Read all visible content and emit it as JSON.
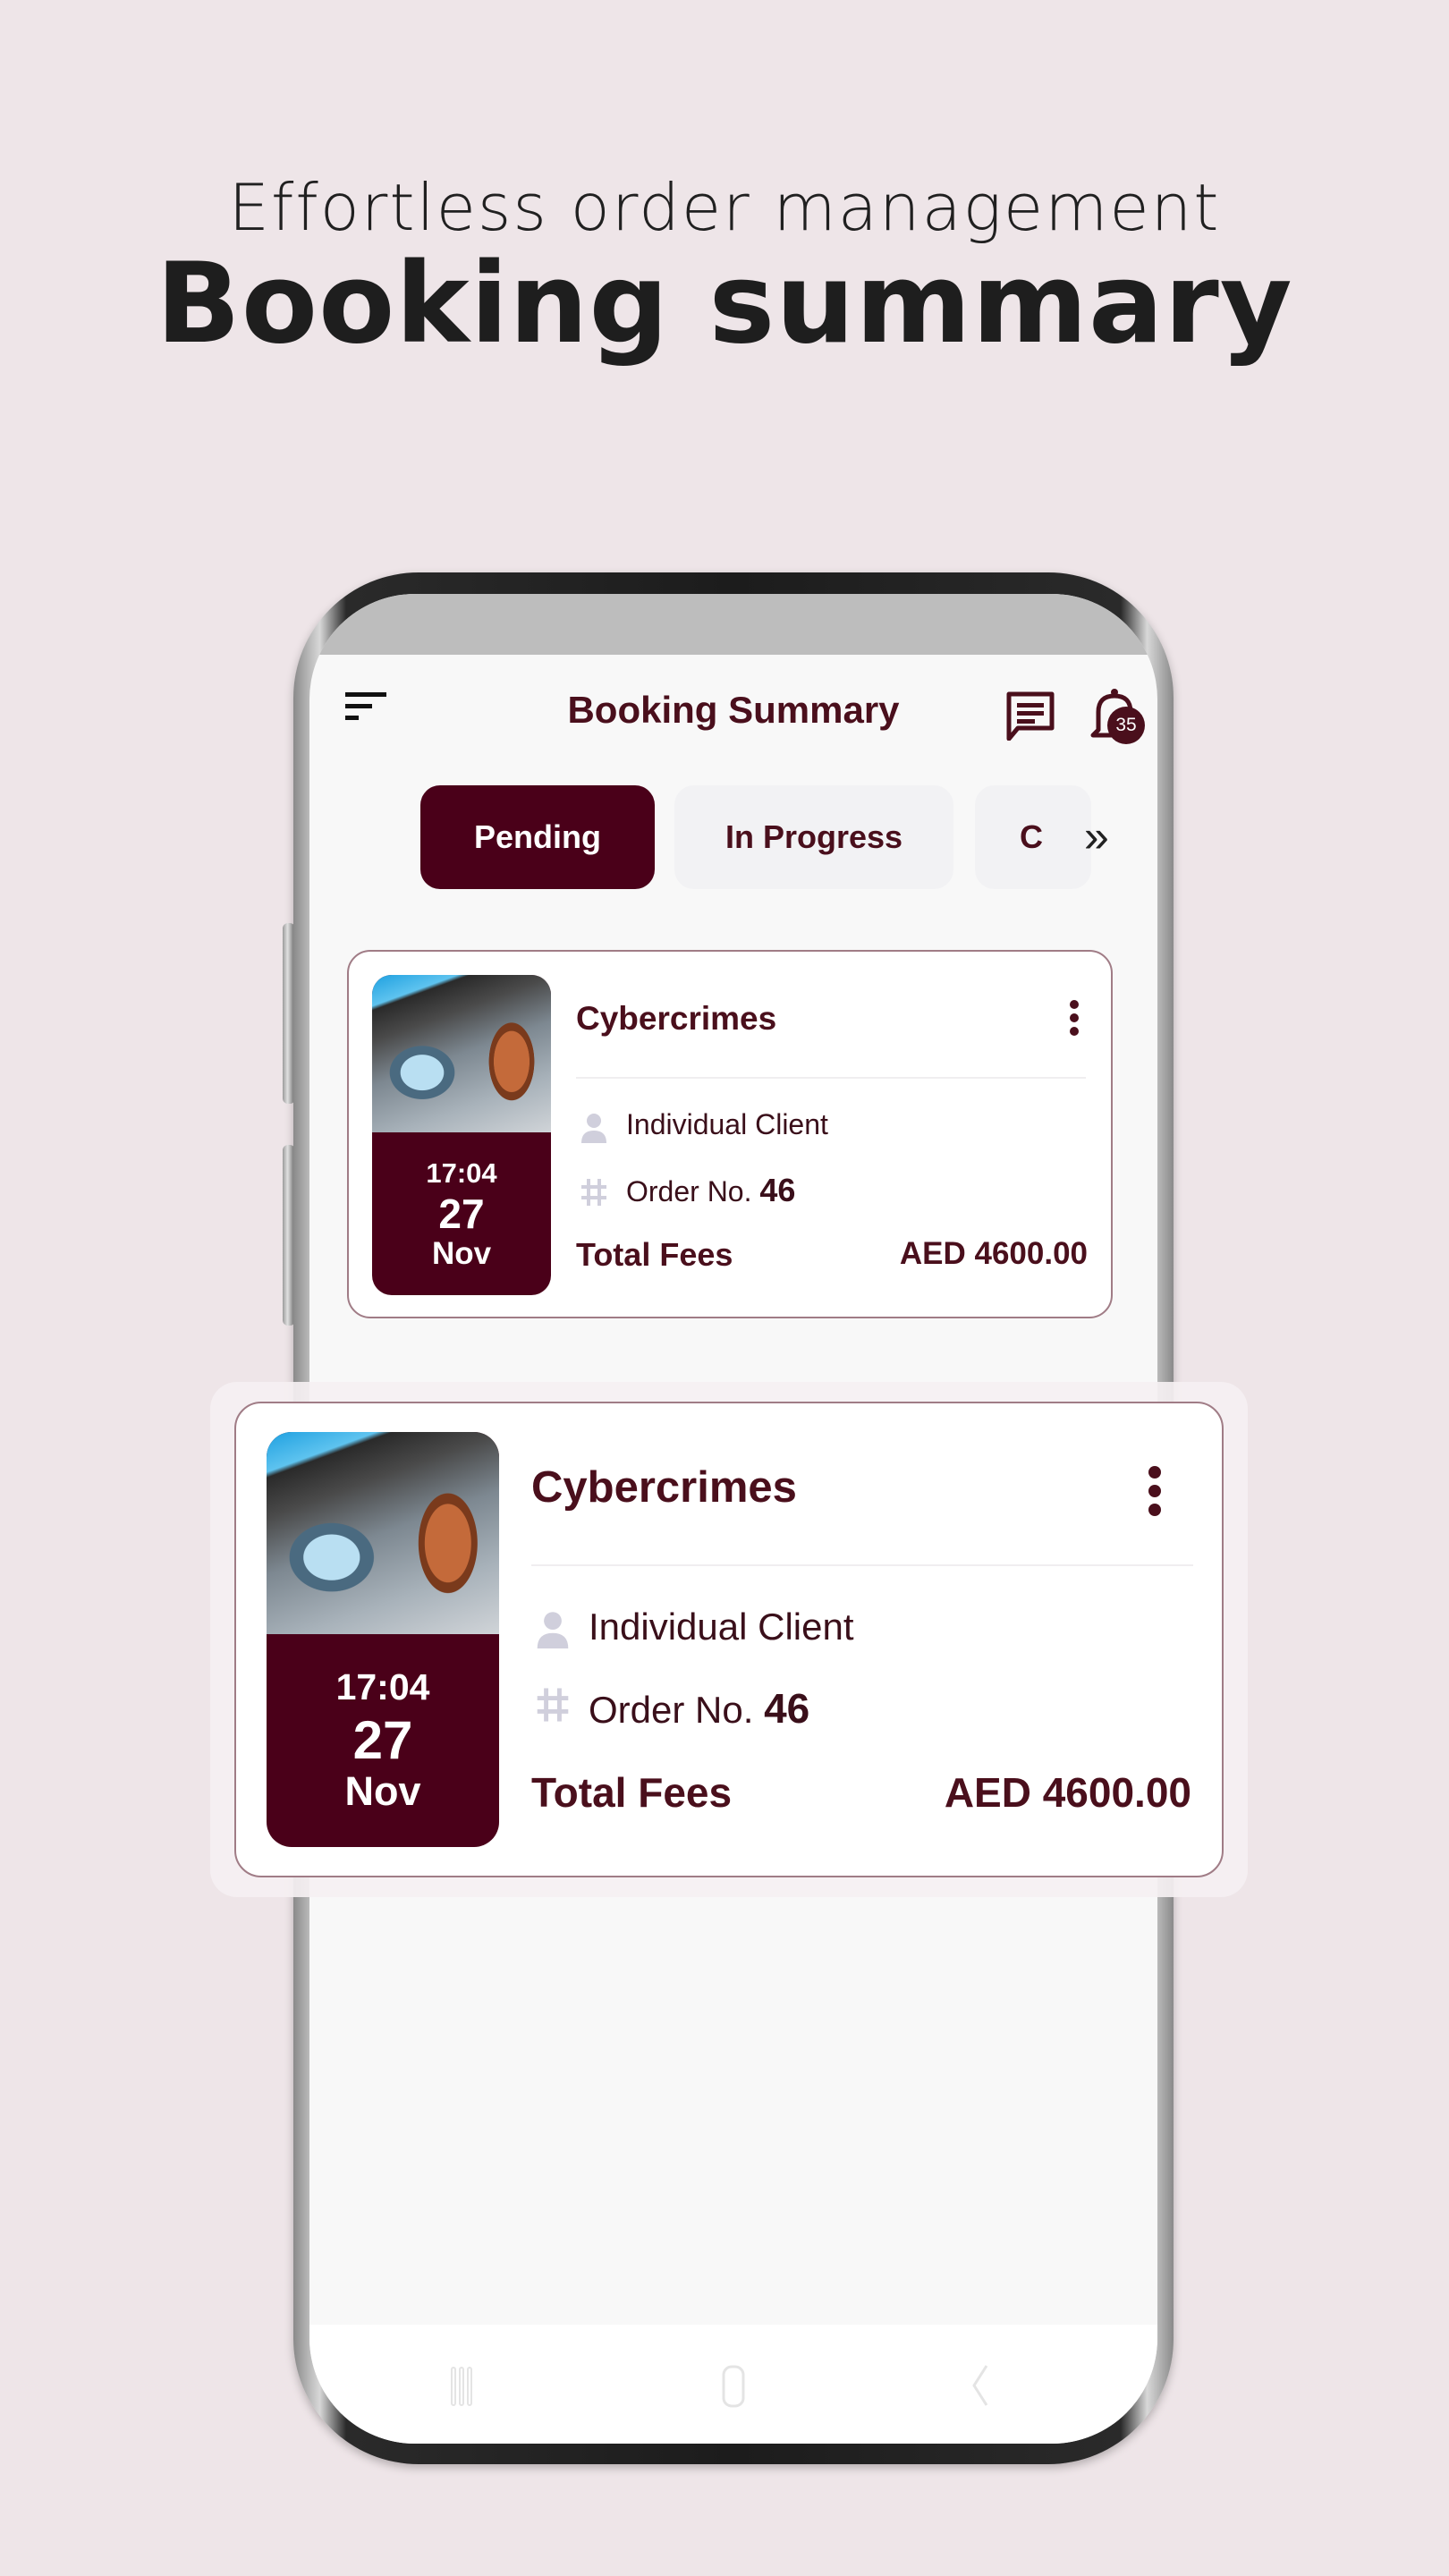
{
  "hero": {
    "subtitle": "Effortless order management",
    "title": "Booking summary"
  },
  "app": {
    "header": {
      "title": "Booking Summary",
      "menu_icon": "filter-menu-icon",
      "chat_icon": "message-icon",
      "notification_icon": "bell-icon",
      "notification_count": "35"
    },
    "tabs": [
      {
        "label": "Pending",
        "active": true
      },
      {
        "label": "In Progress",
        "active": false
      },
      {
        "label": "C",
        "active": false
      }
    ],
    "tabs_more_label": "»",
    "bookings": [
      {
        "category": "Cybercrimes",
        "time": "17:04",
        "day": "27",
        "month": "Nov",
        "client_type": "Individual Client",
        "order_label": "Order No.",
        "order_number": "46",
        "fees_label": "Total Fees",
        "fees_value": "AED 4600.00"
      }
    ],
    "nav_bar": [
      "recent-apps-icon",
      "home-icon",
      "back-icon"
    ],
    "accent_color": "#4a0019"
  },
  "highlight_card": {
    "category": "Cybercrimes",
    "time": "17:04",
    "day": "27",
    "month": "Nov",
    "client_type": "Individual Client",
    "order_label": "Order No.",
    "order_number": "46",
    "fees_label": "Total Fees",
    "fees_value": "AED 4600.00"
  }
}
